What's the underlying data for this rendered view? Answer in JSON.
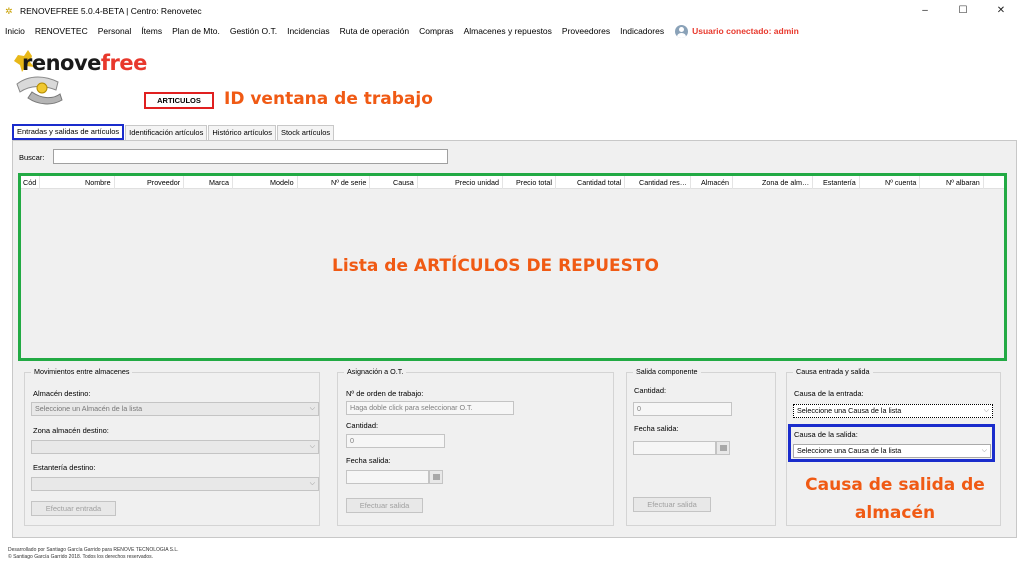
{
  "window": {
    "title": "RENOVEFREE 5.0.4-BETA | Centro: Renovetec",
    "minimize": "–",
    "maximize": "☐",
    "close": "✕"
  },
  "menu": [
    "Inicio",
    "RENOVETEC",
    "Personal",
    "Ítems",
    "Plan de Mto.",
    "Gestión O.T.",
    "Incidencias",
    "Ruta de operación",
    "Compras",
    "Almacenes y repuestos",
    "Proveedores",
    "Indicadores"
  ],
  "user": "Usuario conectado: admin",
  "logo": {
    "part1": "renove",
    "part2": "free"
  },
  "window_id": "ARTICULOS",
  "annotations": {
    "window_id": "ID ventana de trabajo",
    "list": "Lista de ARTÍCULOS DE REPUESTO",
    "exit_cause_line1": "Causa de salida de",
    "exit_cause_line2": "almacén"
  },
  "tabs": [
    "Entradas y salidas de artículos",
    "Identificación artículos",
    "Histórico artículos",
    "Stock artículos"
  ],
  "search": {
    "label": "Buscar:",
    "value": ""
  },
  "columns": [
    "Cód",
    "Nombre",
    "Proveedor",
    "Marca",
    "Modelo",
    "Nº de serie",
    "Causa",
    "Precio unidad",
    "Precio total",
    "Cantidad total",
    "Cantidad res…",
    "Almacén",
    "Zona de alm…",
    "Estantería",
    "Nº cuenta",
    "Nº albaran"
  ],
  "movements": {
    "title": "Movimientos entre almacenes",
    "dest_label": "Almacén destino:",
    "dest_placeholder": "Seleccione un Almacén de la lista",
    "zone_label": "Zona almacén destino:",
    "zone_value": "",
    "shelf_label": "Estantería destino:",
    "shelf_value": "",
    "button": "Efectuar entrada"
  },
  "assignment": {
    "title": "Asignación a O.T.",
    "order_label": "Nº de orden de trabajo:",
    "order_placeholder": "Haga doble click para seleccionar O.T.",
    "qty_label": "Cantidad:",
    "qty_value": "0",
    "date_label": "Fecha salida:",
    "date_value": "",
    "button": "Efectuar salida"
  },
  "component_exit": {
    "title": "Salida componente",
    "qty_label": "Cantidad:",
    "qty_value": "0",
    "date_label": "Fecha salida:",
    "date_value": "",
    "button": "Efectuar salida"
  },
  "cause": {
    "title": "Causa entrada y salida",
    "entry_label": "Causa de la entrada:",
    "entry_placeholder": "Seleccione una Causa de la lista",
    "exit_label": "Causa de la salida:",
    "exit_placeholder": "Seleccione una Causa de la lista"
  },
  "footer": {
    "line1": "Desarrollado por Santiago García Garrido para RENOVE TECNOLOGIA S.L.",
    "line2": "© Santiago García Garrido 2018. Todos los derechos reservados."
  },
  "colors": {
    "accent_red": "#e02020",
    "annotation_orange": "#f05a14",
    "highlight_blue": "#1a2ccc",
    "list_green": "#22aa44"
  }
}
